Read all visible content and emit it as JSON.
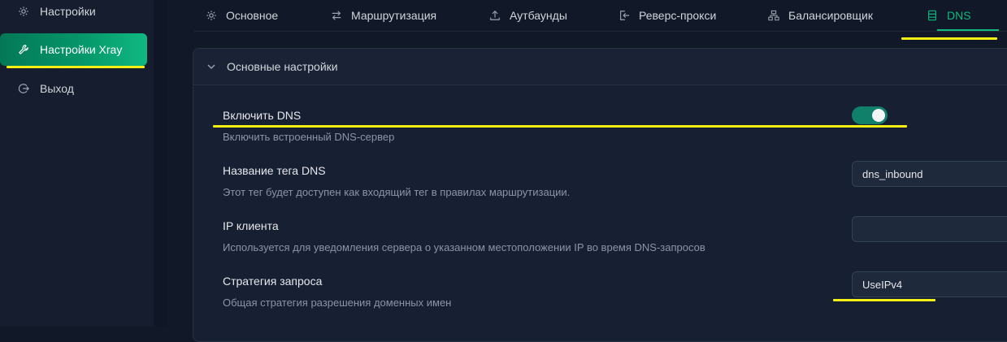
{
  "sidebar": {
    "items": [
      {
        "label": "Настройки",
        "icon": "gear-icon"
      },
      {
        "label": "Настройки Xray",
        "icon": "wrench-icon"
      },
      {
        "label": "Выход",
        "icon": "logout-icon"
      }
    ]
  },
  "tabs": [
    {
      "label": "Основное",
      "icon": "gear-icon"
    },
    {
      "label": "Маршрутизация",
      "icon": "swap-icon"
    },
    {
      "label": "Аутбаунды",
      "icon": "upload-icon"
    },
    {
      "label": "Реверс-прокси",
      "icon": "import-icon"
    },
    {
      "label": "Балансировщик",
      "icon": "cluster-icon"
    },
    {
      "label": "DNS",
      "icon": "database-icon"
    }
  ],
  "section": {
    "title": "Основные настройки"
  },
  "settings": {
    "enable_dns": {
      "title": "Включить DNS",
      "desc": "Включить встроенный DNS-сервер",
      "on": true
    },
    "tag_name": {
      "title": "Название тега DNS",
      "desc": "Этот тег будет доступен как входящий тег в правилах маршрутизации.",
      "value": "dns_inbound"
    },
    "client_ip": {
      "title": "IP клиента",
      "desc": "Используется для уведомления сервера о указанном местоположении IP во время DNS-запросов",
      "value": ""
    },
    "strategy": {
      "title": "Стратегия запроса",
      "desc": "Общая стратегия разрешения доменных имен",
      "value": "UseIPv4"
    }
  },
  "colors": {
    "accent": "#10b981",
    "highlight": "#f5ef14",
    "background": "#111827"
  }
}
